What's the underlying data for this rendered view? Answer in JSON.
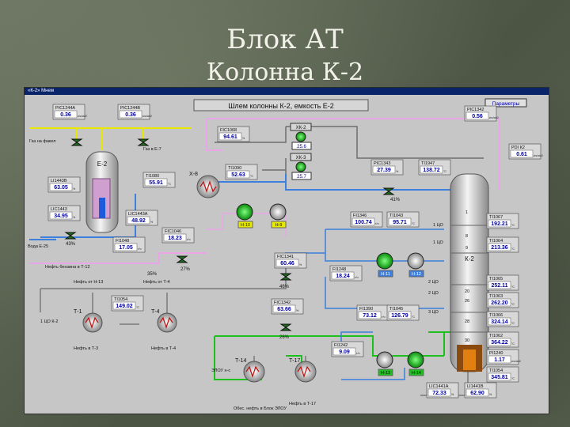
{
  "slide": {
    "title_line1": "Блок АТ",
    "title_line2": "Колонна К-2"
  },
  "window": {
    "title": "«К-2» Мнем"
  },
  "banner": "Шлем колонны К-2, емкость Е-2",
  "parameters_button": "Параметры",
  "vessels": {
    "e2": "Е-2",
    "k2": "К-2"
  },
  "exchangers": {
    "x8": "Х-8",
    "t1": "Т-1",
    "t4": "Т-4",
    "t14": "Т-14",
    "t17": "Т-17"
  },
  "pumps": {
    "n10": "Н-10",
    "n9": "Н-9",
    "n11": "Н-11",
    "n12": "Н-12",
    "n13": "Н-13",
    "n14": "Н-14"
  },
  "instruments": [
    {
      "id": "pic1244a",
      "tag": "PIC1244A",
      "value": "0.36",
      "unit": "кгс/см2"
    },
    {
      "id": "pic1244b",
      "tag": "PIC1244B",
      "value": "0.36",
      "unit": "кгс/см2"
    },
    {
      "id": "fic1068",
      "tag": "FIC1068",
      "value": "94.61",
      "unit": "%"
    },
    {
      "id": "ti1080",
      "tag": "TI1080",
      "value": "55.91",
      "unit": "°C"
    },
    {
      "id": "ti1090",
      "tag": "TI1090",
      "value": "52.63",
      "unit": "°C"
    },
    {
      "id": "li1443b",
      "tag": "LI1443B",
      "value": "63.05",
      "unit": "%"
    },
    {
      "id": "lic1443",
      "tag": "LIC1443",
      "value": "34.95",
      "unit": "%"
    },
    {
      "id": "lic1443a",
      "tag": "LIC1443A",
      "value": "48.92",
      "unit": "%"
    },
    {
      "id": "fic1046",
      "tag": "FIC1046",
      "value": "18.23",
      "unit": "т/ч"
    },
    {
      "id": "fi1048",
      "tag": "FI1048",
      "value": "17.05",
      "unit": "т/ч"
    },
    {
      "id": "pic1343",
      "tag": "PIC1343",
      "value": "27.39",
      "unit": "%"
    },
    {
      "id": "ti1947",
      "tag": "TI1947",
      "value": "138.72",
      "unit": "°C"
    },
    {
      "id": "pic1342",
      "tag": "PIC1342",
      "value": "0.56",
      "unit": "кгс/см2"
    },
    {
      "id": "pdi1k2",
      "tag": "PDI К2",
      "value": "0.61",
      "unit": "кгс/см2"
    },
    {
      "id": "fi1346",
      "tag": "FI1346",
      "value": "100.74",
      "unit": "т/ч"
    },
    {
      "id": "ti1043",
      "tag": "TI1043",
      "value": "95.71",
      "unit": "°C"
    },
    {
      "id": "ti1067",
      "tag": "TI1067",
      "value": "192.21",
      "unit": "°C"
    },
    {
      "id": "ti1064",
      "tag": "TI1064",
      "value": "213.36",
      "unit": "°C"
    },
    {
      "id": "fic1341",
      "tag": "FIC1341",
      "value": "60.46",
      "unit": "%"
    },
    {
      "id": "fi1248",
      "tag": "FI1248",
      "value": "18.24",
      "unit": "т/ч"
    },
    {
      "id": "ti1054",
      "tag": "TI1054",
      "value": "149.02",
      "unit": "°C"
    },
    {
      "id": "fic1342",
      "tag": "FIC1342",
      "value": "63.66",
      "unit": "%"
    },
    {
      "id": "fi1390",
      "tag": "FI1390",
      "value": "73.12",
      "unit": "т/ч"
    },
    {
      "id": "ti1045",
      "tag": "TI1045",
      "value": "126.79",
      "unit": "°C"
    },
    {
      "id": "ti1065",
      "tag": "TI1065",
      "value": "252.11",
      "unit": "°C"
    },
    {
      "id": "ti1063",
      "tag": "TI1063",
      "value": "262.20",
      "unit": "°C"
    },
    {
      "id": "ti1066",
      "tag": "TI1066",
      "value": "324.14",
      "unit": "°C"
    },
    {
      "id": "ti1062",
      "tag": "TI1062",
      "value": "364.22",
      "unit": "°C"
    },
    {
      "id": "fi1242",
      "tag": "FI1242",
      "value": "9.09",
      "unit": "т/ч"
    },
    {
      "id": "pi1240",
      "tag": "PI1240",
      "value": "1.17",
      "unit": "кгс/см2"
    },
    {
      "id": "ti1054b",
      "tag": "TI1054",
      "value": "345.81",
      "unit": "°C"
    },
    {
      "id": "lic1441a",
      "tag": "LIC1441A",
      "value": "72.33",
      "unit": "%"
    },
    {
      "id": "li1441b",
      "tag": "LI1441B",
      "value": "62.90",
      "unit": "%"
    }
  ],
  "xk": {
    "xk2_label": "ХК-2",
    "xk2_value": "25.6",
    "xk3_label": "ХК-3",
    "xk3_value": "25.7"
  },
  "valve_pct": {
    "v1": "43%",
    "v2": "35%",
    "v3": "27%",
    "v4": "46%",
    "v5": "26%",
    "v6": "41%"
  },
  "stream_labels": {
    "gas_to_fakel": "Газ на факел",
    "gas_to_e7": "Газ в Е-7",
    "water_e25": "Вода Е-25",
    "naphtha_to_t12": "Нефть бензина в Т-12",
    "oil_from_n13": "Нефть от Н-13",
    "oil_from_t4": "Нефть от Т-4",
    "oil_to_t3": "Нефть в Т-3",
    "oil_to_t4": "Нефть в Т-4",
    "cw_in": "1 ЦО К-2",
    "so_in": "ЭЛОУ н-с",
    "desalted_oil": "Обес. нефть в Блок ЭЛОУ",
    "oil_to_t17": "Нефть в Т-17",
    "co1_a": "1 ЦО",
    "co1_b": "1 ЦО",
    "co2_a": "2 ЦО",
    "co2_b": "2 ЦО",
    "co3": "3 ЦО"
  },
  "trays": [
    "1",
    "8",
    "9",
    "20",
    "26",
    "28",
    "30"
  ]
}
